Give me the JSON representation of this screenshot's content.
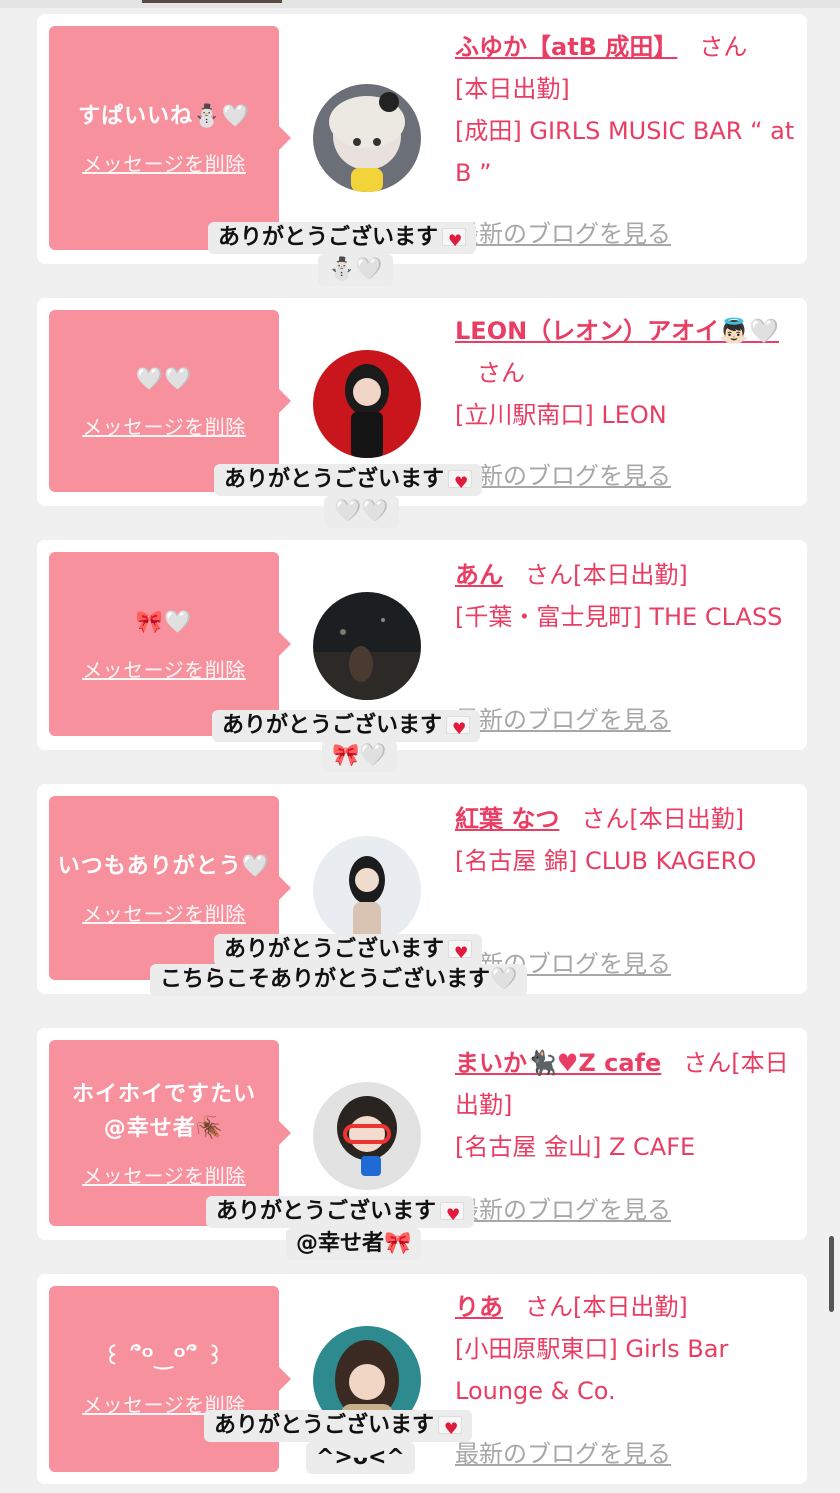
{
  "colors": {
    "accent": "#e93d63",
    "bubble": "#f7919d",
    "reply_bg": "#ececec",
    "link_gray": "#a7a7a7"
  },
  "delete_label": "メッセージを削除",
  "blog_label": "最新のブログを見る",
  "san_label": "さん",
  "cards": [
    {
      "message": "すぱいいね⛄🤍",
      "name": "ふゆか【atB 成田】",
      "status": "[本日出勤]",
      "shop": "[成田] GIRLS MUSIC BAR “ at B ”",
      "reply_line1": "ありがとうございます",
      "reply_line2": "⛄🤍"
    },
    {
      "message": "🤍🤍",
      "name": "LEON（レオン）アオイ👼🏻🤍",
      "status": "",
      "shop": "[立川駅南口] LEON",
      "reply_line1": "ありがとうございます",
      "reply_line2": "🤍🤍"
    },
    {
      "message": "🎀🤍",
      "name": "あん",
      "status": "[本日出勤]",
      "shop": "[千葉・富士見町] THE CLASS",
      "reply_line1": "ありがとうございます",
      "reply_line2": "🎀🤍"
    },
    {
      "message": "いつもありがとう🤍",
      "name": "紅葉 なつ",
      "status": "[本日出勤]",
      "shop": "[名古屋 錦] CLUB KAGERO",
      "reply_line1": "ありがとうございます",
      "reply_line2": "こちらこそありがとうございます🤍"
    },
    {
      "message": "ホイホイですたい@幸せ者🪳",
      "name": "まいか🐈‍⬛♥Z cafe",
      "status": "[本日出勤]",
      "shop": "[名古屋 金山] Z CAFE",
      "reply_line1": "ありがとうございます",
      "reply_line2": "@幸せ者🎀"
    },
    {
      "message": "꒰ ՞ᴼ‿ᴼ՞ ꒱",
      "name": "りあ",
      "status": "[本日出勤]",
      "shop": "[小田原駅東口] Girls Bar Lounge & Co.",
      "reply_line1": "ありがとうございます",
      "reply_line2": "^>ᴗ<^"
    }
  ]
}
